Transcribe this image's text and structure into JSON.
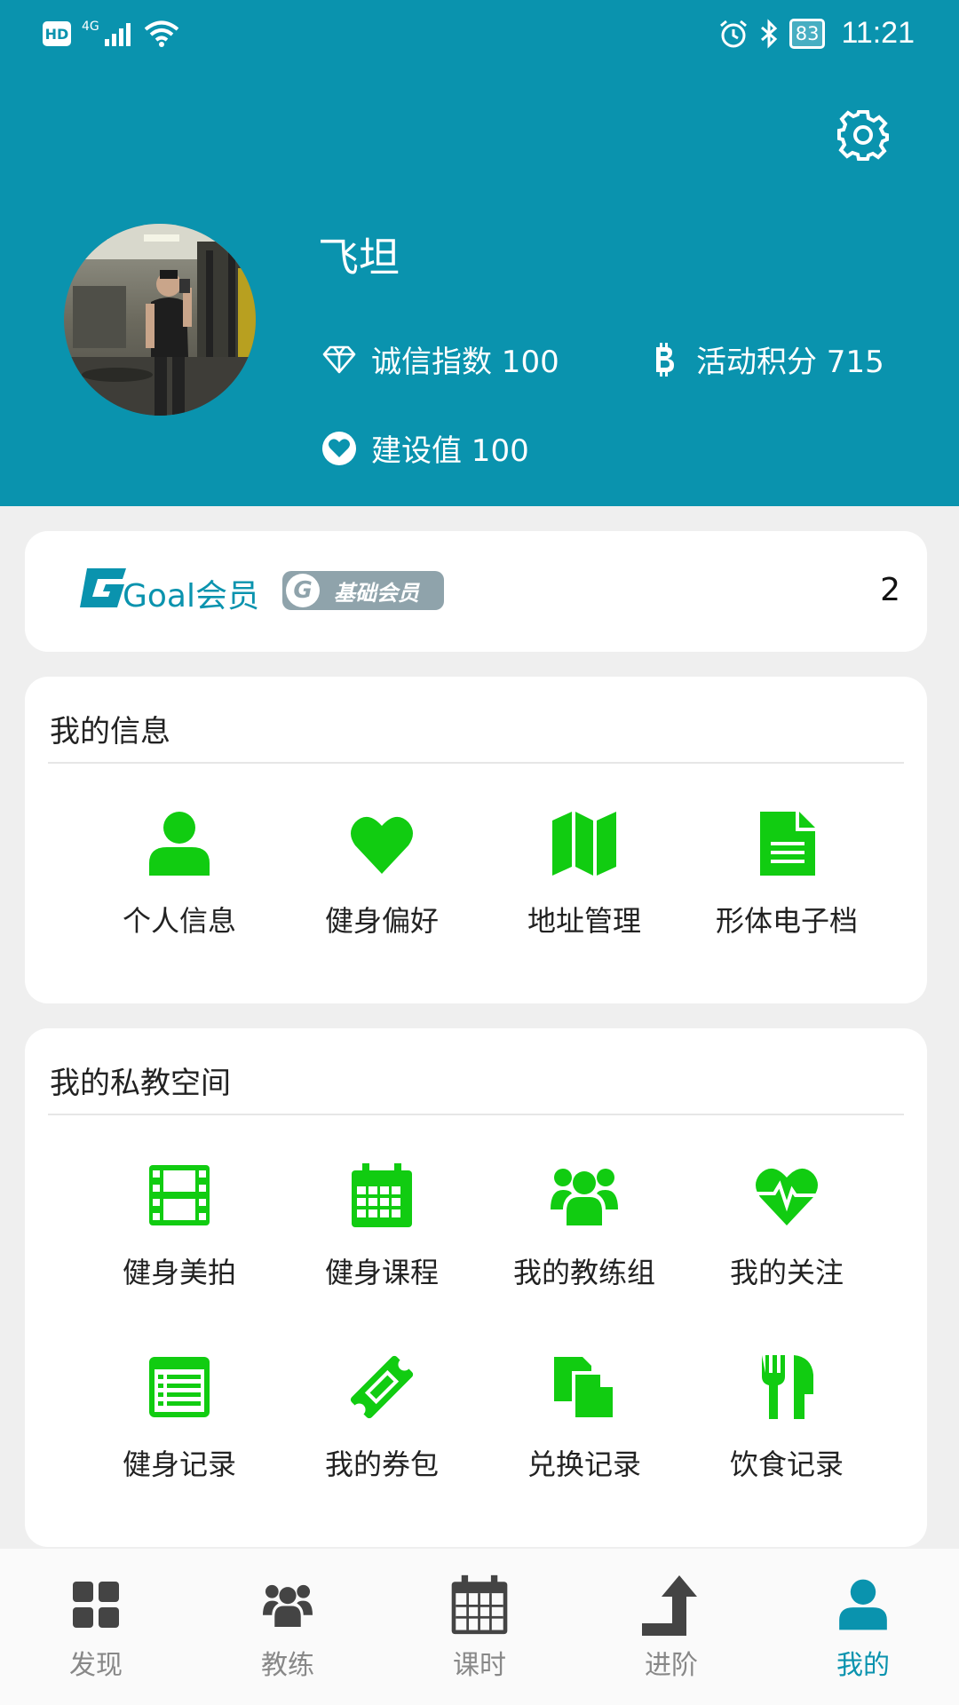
{
  "status_bar": {
    "network": "4G",
    "hd": "HD",
    "battery": "83",
    "time": "11:21"
  },
  "profile": {
    "name": "飞坦",
    "integrity": "诚信指数 100",
    "points": "活动积分 715",
    "build_value": "建设值 100"
  },
  "membership": {
    "label": "Goal会员",
    "badge": "基础会员",
    "badge_logo": "G",
    "count": "2"
  },
  "my_info": {
    "title": "我的信息",
    "items": [
      {
        "label": "个人信息",
        "icon": "person-icon"
      },
      {
        "label": "健身偏好",
        "icon": "heart-icon"
      },
      {
        "label": "地址管理",
        "icon": "map-icon"
      },
      {
        "label": "形体电子档",
        "icon": "document-icon"
      }
    ]
  },
  "coach_space": {
    "title": "我的私教空间",
    "items": [
      {
        "label": "健身美拍",
        "icon": "film-icon"
      },
      {
        "label": "健身课程",
        "icon": "calendar-icon"
      },
      {
        "label": "我的教练组",
        "icon": "group-icon"
      },
      {
        "label": "我的关注",
        "icon": "heartbeat-icon"
      },
      {
        "label": "健身记录",
        "icon": "list-icon"
      },
      {
        "label": "我的券包",
        "icon": "ticket-icon"
      },
      {
        "label": "兑换记录",
        "icon": "copy-icon"
      },
      {
        "label": "饮食记录",
        "icon": "utensils-icon"
      }
    ]
  },
  "bottom_nav": [
    {
      "label": "发现",
      "icon": "grid-icon"
    },
    {
      "label": "教练",
      "icon": "group-icon"
    },
    {
      "label": "课时",
      "icon": "calendar-icon"
    },
    {
      "label": "进阶",
      "icon": "turn-up-arrow-icon"
    },
    {
      "label": "我的",
      "icon": "user-icon",
      "active": true
    }
  ],
  "colors": {
    "primary": "#0a93ae",
    "icon_green": "#11cc11",
    "nav_inactive": "#444444"
  }
}
